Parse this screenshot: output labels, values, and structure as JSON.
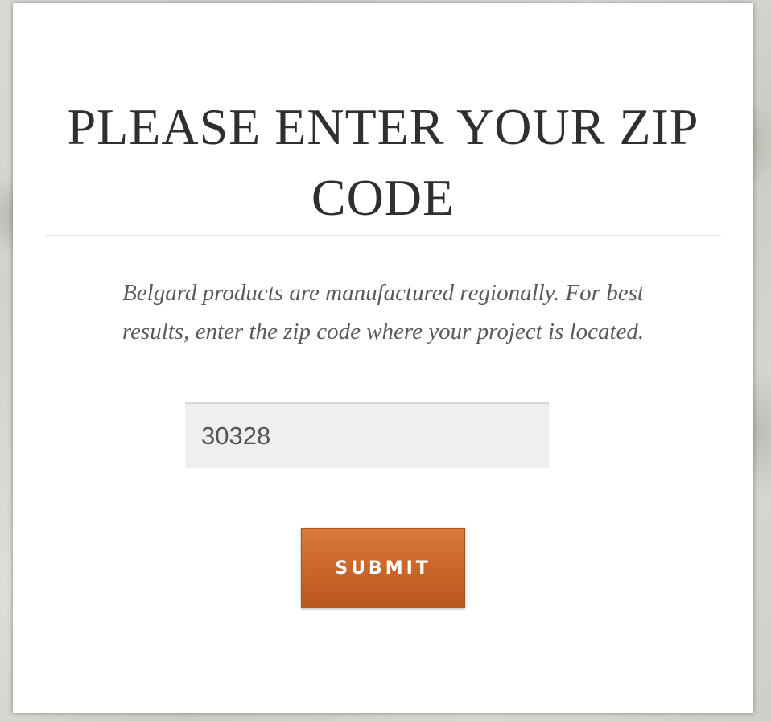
{
  "modal": {
    "title": "PLEASE ENTER YOUR ZIP CODE",
    "description": "Belgard products are manufactured regionally. For best results, enter the zip code where your project is located.",
    "zip_input": {
      "value": "30328"
    },
    "submit_label": "SUBMIT"
  },
  "colors": {
    "button_accent": "#c8652b",
    "title_text": "#2f2f2f",
    "input_background": "#efefef"
  }
}
